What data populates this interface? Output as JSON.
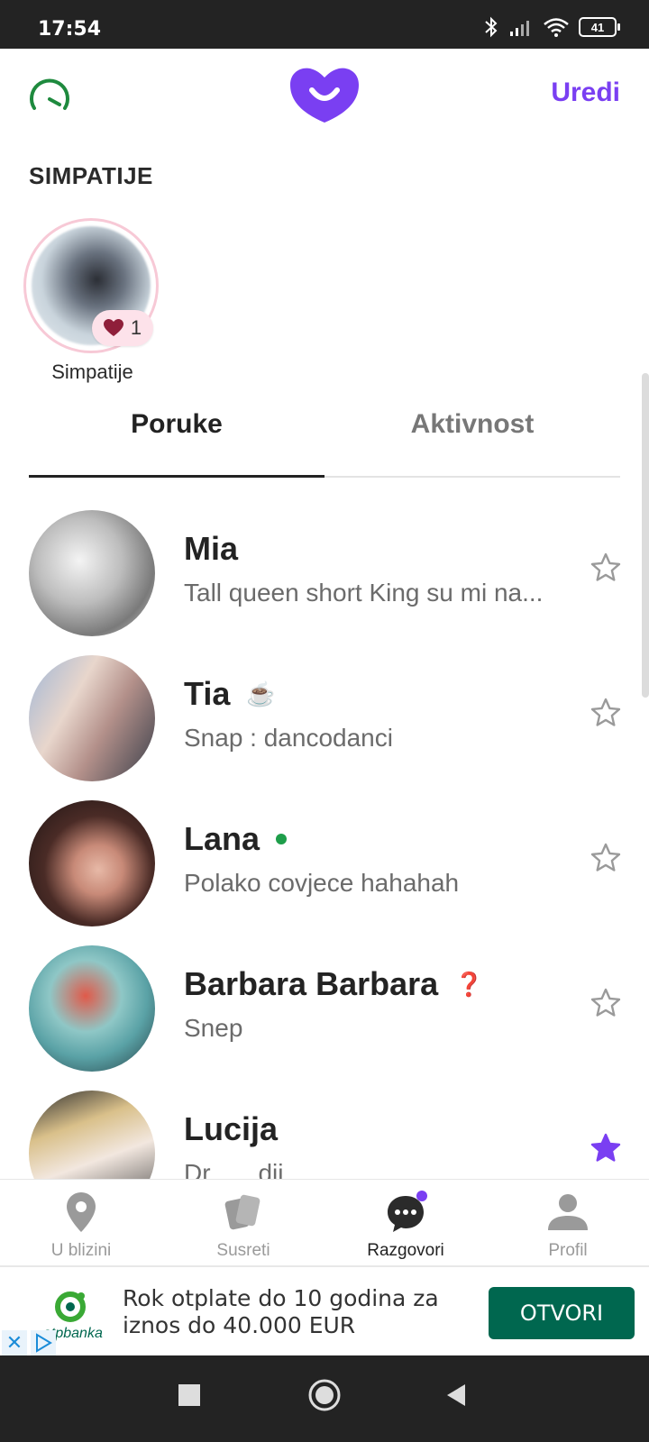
{
  "status_bar": {
    "time": "17:54",
    "battery": "41"
  },
  "header": {
    "edit_label": "Uredi"
  },
  "likes": {
    "title": "SIMPATIJE",
    "count": "1",
    "label": "Simpatije"
  },
  "tabs": [
    {
      "label": "Poruke"
    },
    {
      "label": "Aktivnost"
    }
  ],
  "conversations": [
    {
      "name": "Mia",
      "message": "Tall queen short King su mi na...",
      "emoji": "",
      "online": false,
      "starred": false
    },
    {
      "name": "Tia",
      "message": "Snap : dancodanci",
      "emoji": "☕",
      "online": false,
      "starred": false
    },
    {
      "name": "Lana",
      "message": "Polako covjece hahahah",
      "emoji": "",
      "online": true,
      "starred": false
    },
    {
      "name": "Barbara Barbara",
      "message": "Snep",
      "emoji": "❓",
      "online": false,
      "starred": true
    },
    {
      "name": "Lucija",
      "message": "Dr... ...dij...",
      "emoji": "",
      "online": false,
      "starred": true
    }
  ],
  "bottom_nav": [
    {
      "label": "U blizini"
    },
    {
      "label": "Susreti"
    },
    {
      "label": "Razgovori"
    },
    {
      "label": "Profil"
    }
  ],
  "ad": {
    "brand": "otpbanka",
    "text": "Rok otplate do 10 godina za iznos do 40.000 EUR",
    "button_label": "OTVORI"
  },
  "colors": {
    "accent": "#7a3ff2",
    "online": "#1e9e4a",
    "ad_button": "#00674f",
    "speed_icon": "#1e8a3e"
  }
}
